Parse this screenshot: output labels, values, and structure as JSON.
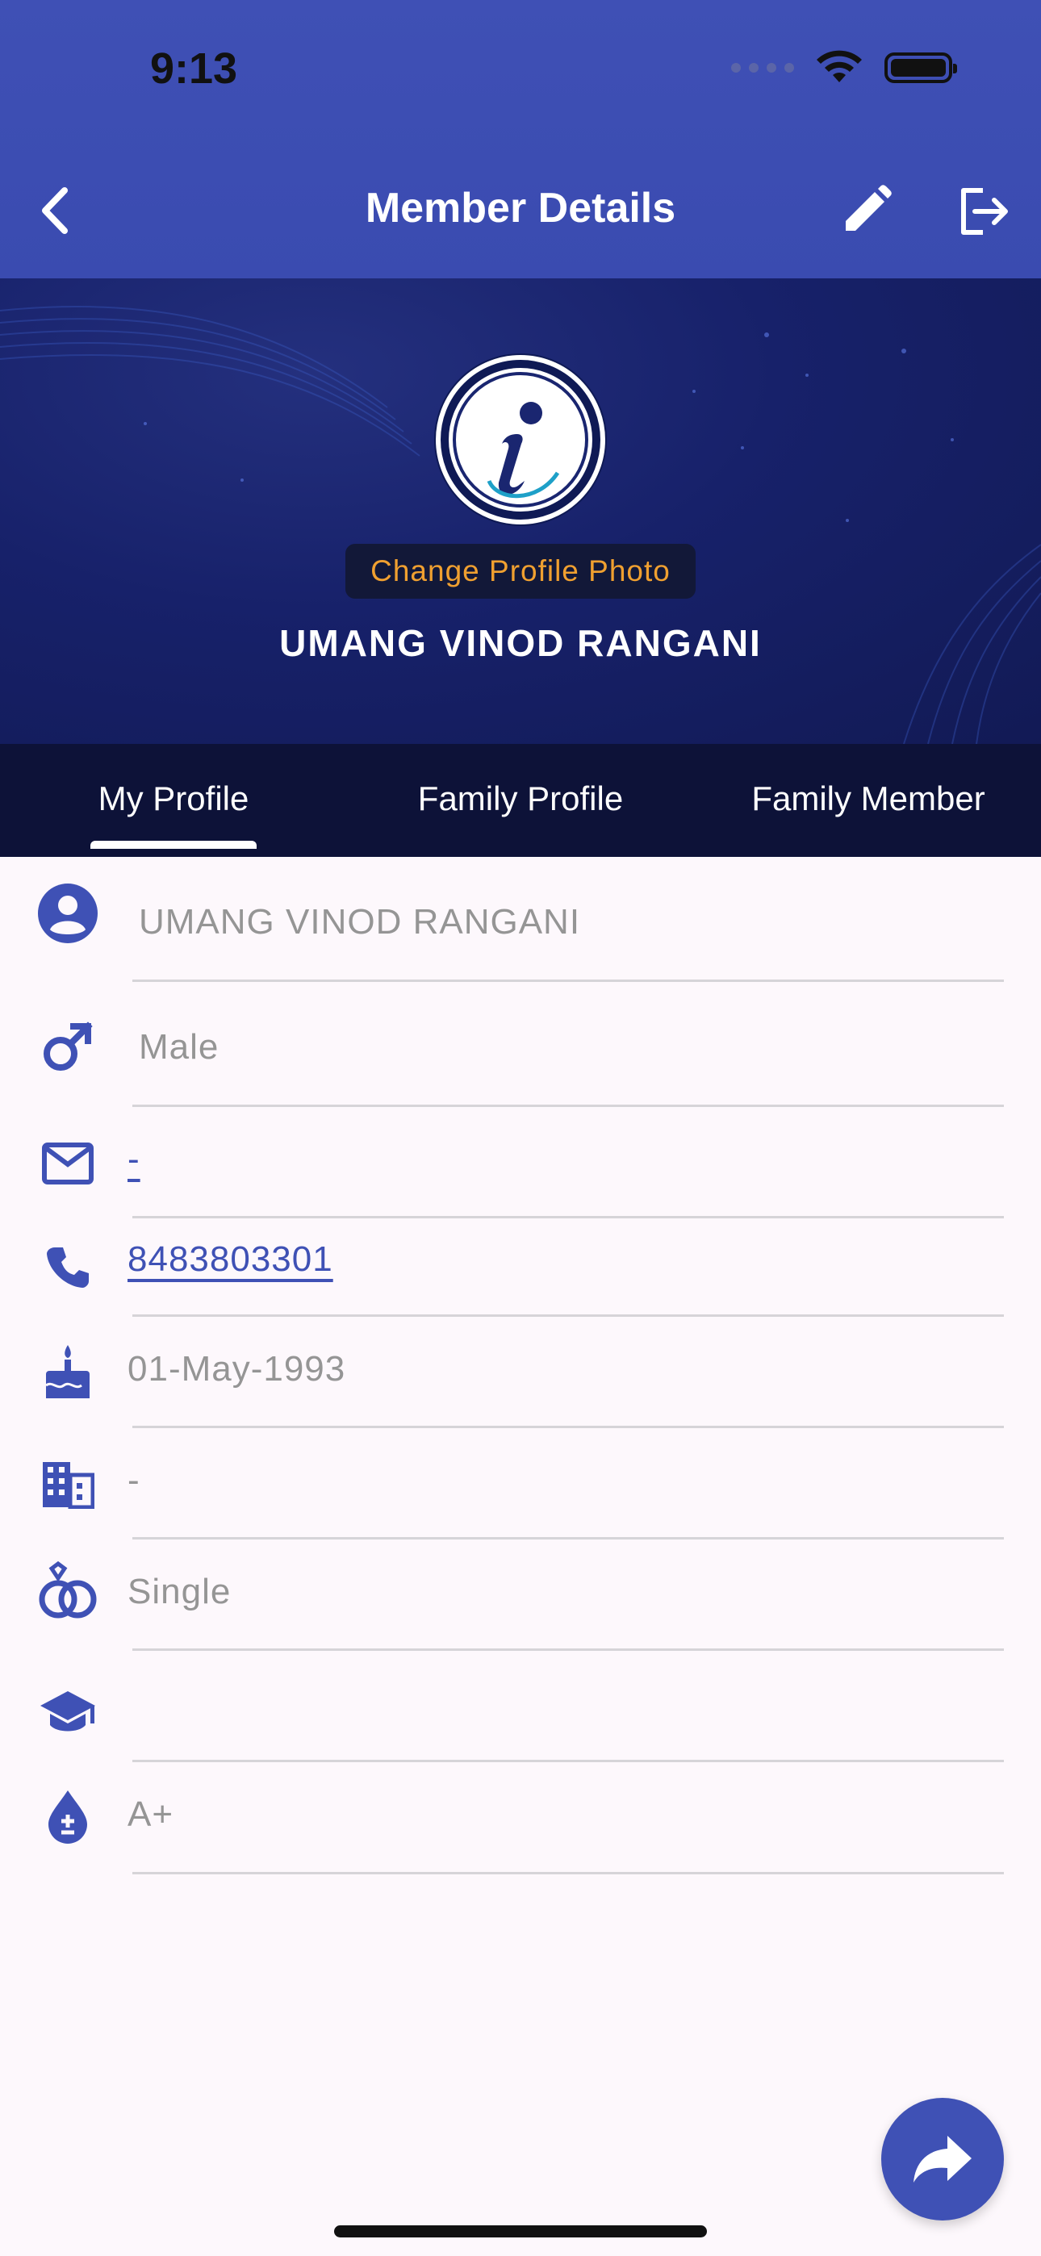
{
  "status_bar": {
    "time": "9:13"
  },
  "header": {
    "title": "Member Details"
  },
  "profile": {
    "change_photo_label": "Change Profile Photo",
    "name": "UMANG VINOD RANGANI"
  },
  "tabs": [
    {
      "label": "My Profile",
      "active": true
    },
    {
      "label": "Family Profile",
      "active": false
    },
    {
      "label": "Family Member",
      "active": false
    }
  ],
  "details": {
    "full_name": "UMANG VINOD RANGANI",
    "gender": "Male",
    "email": "-",
    "phone": "8483803301",
    "birth_date": "01-May-1993",
    "company": "-",
    "marital_status": "Single",
    "education": "",
    "blood_group": "A+"
  },
  "colors": {
    "primary": "#3f51b5",
    "hero_dark": "#17216a",
    "tab_bar": "#0d1238",
    "accent_orange": "#f0a030"
  }
}
